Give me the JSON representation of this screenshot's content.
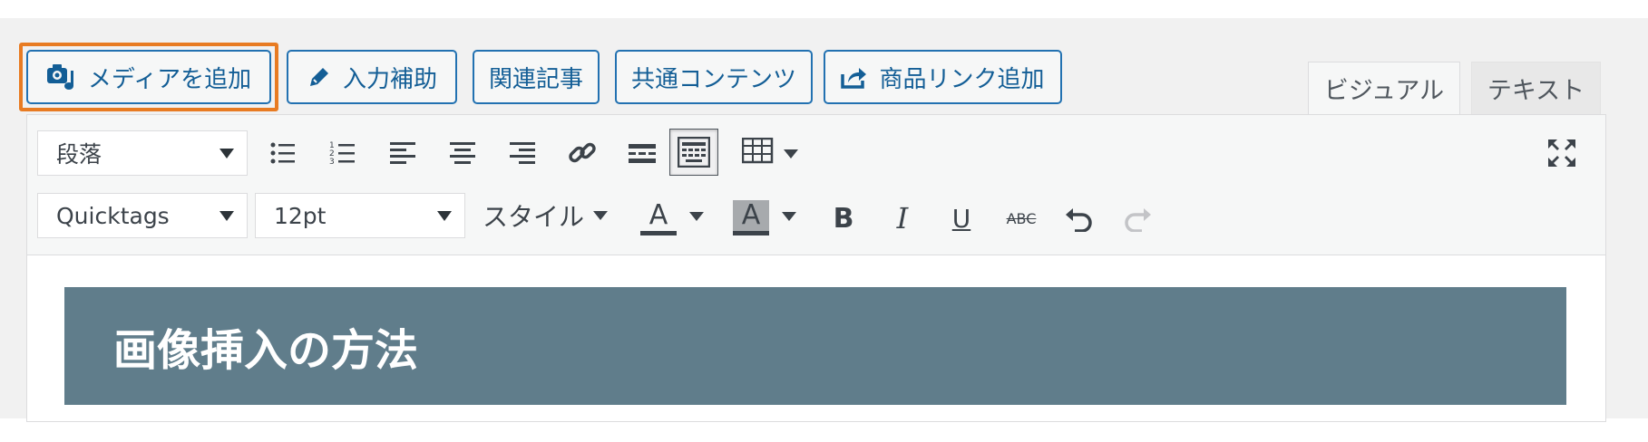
{
  "media_buttons": {
    "add_media": "メディアを追加",
    "input_assist": "入力補助",
    "related_posts": "関連記事",
    "common_content": "共通コンテンツ",
    "add_product_link": "商品リンク追加"
  },
  "tabs": {
    "visual": "ビジュアル",
    "text": "テキスト"
  },
  "toolbar": {
    "format_select": "段落",
    "quicktags_select": "Quicktags",
    "font_size_select": "12pt",
    "style_menu": "スタイル",
    "text_color_label": "A",
    "bg_color_label": "A",
    "bold_label": "B",
    "italic_label": "I",
    "underline_label": "U",
    "strike_label": "ABC"
  },
  "content": {
    "heading": "画像挿入の方法"
  },
  "colors": {
    "button_border": "#2271b1",
    "highlight": "#e87b22",
    "heading_bg": "#607d8b"
  },
  "icons": [
    "camera-music-icon",
    "pencil-icon",
    "share-icon",
    "bullet-list-icon",
    "numbered-list-icon",
    "align-left-icon",
    "align-center-icon",
    "align-right-icon",
    "link-icon",
    "more-tag-icon",
    "toolbar-toggle-icon",
    "table-icon",
    "fullscreen-icon",
    "undo-icon",
    "redo-icon"
  ]
}
